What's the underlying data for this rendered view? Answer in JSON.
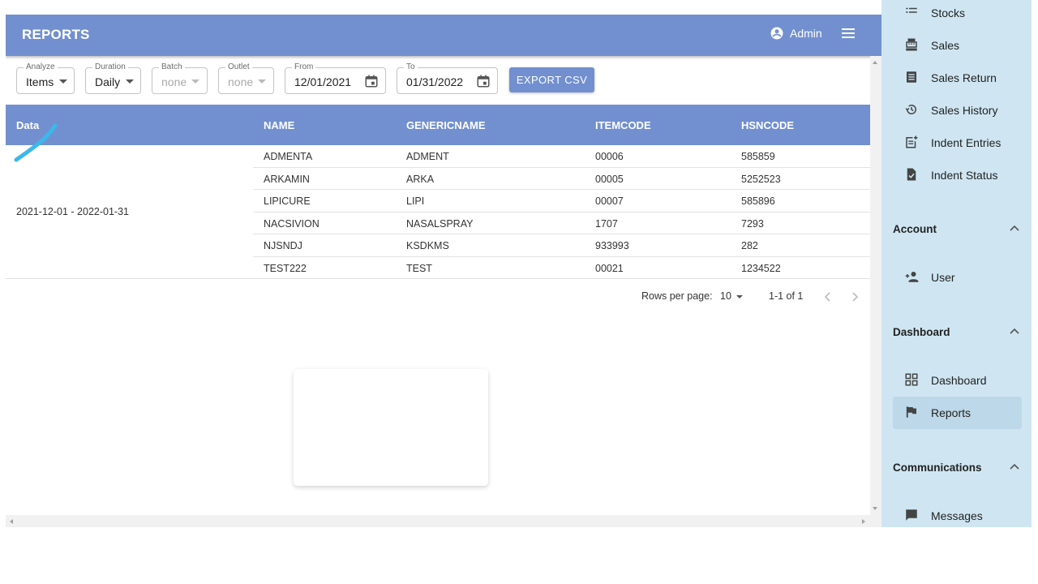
{
  "header": {
    "title": "REPORTS",
    "user_label": "Admin"
  },
  "filters": {
    "analyze": {
      "label": "Analyze",
      "value": "Items"
    },
    "duration": {
      "label": "Duration",
      "value": "Daily"
    },
    "batch": {
      "label": "Batch",
      "value": "none"
    },
    "outlet": {
      "label": "Outlet",
      "value": "none"
    },
    "from": {
      "label": "From",
      "value": "12/01/2021"
    },
    "to": {
      "label": "To",
      "value": "01/31/2022"
    },
    "export_label": "EXPORT CSV"
  },
  "table": {
    "columns": [
      "Data",
      "NAME",
      "GENERICNAME",
      "ITEMCODE",
      "HSNCODE"
    ],
    "data_range": "2021-12-01 - 2022-01-31",
    "rows": [
      {
        "name": "ADMENTA",
        "generic": "ADMENT",
        "itemcode": "00006",
        "hsn": "585859"
      },
      {
        "name": "ARKAMIN",
        "generic": "ARKA",
        "itemcode": "00005",
        "hsn": "5252523"
      },
      {
        "name": "LIPICURE",
        "generic": "LIPI",
        "itemcode": "00007",
        "hsn": "585896"
      },
      {
        "name": "NACSIVION",
        "generic": "NASALSPRAY",
        "itemcode": "1707",
        "hsn": "7293"
      },
      {
        "name": "NJSNDJ",
        "generic": "KSDKMS",
        "itemcode": "933993",
        "hsn": "282"
      },
      {
        "name": "TEST222",
        "generic": "TEST",
        "itemcode": "00021",
        "hsn": "1234522"
      }
    ]
  },
  "pagination": {
    "rows_per_page_label": "Rows per page:",
    "rows_per_page": "10",
    "range": "1-1 of 1"
  },
  "sidebar": {
    "items_top": [
      {
        "label": "Stocks",
        "icon": "list-icon"
      },
      {
        "label": "Sales",
        "icon": "cash-register-icon"
      },
      {
        "label": "Sales Return",
        "icon": "receipt-icon"
      },
      {
        "label": "Sales History",
        "icon": "history-icon"
      },
      {
        "label": "Indent Entries",
        "icon": "post-add-icon"
      },
      {
        "label": "Indent Status",
        "icon": "file-check-icon"
      }
    ],
    "sections": {
      "account": "Account",
      "dashboard": "Dashboard",
      "communications": "Communications"
    },
    "account_items": [
      {
        "label": "User",
        "icon": "person-add-icon"
      }
    ],
    "dashboard_items": [
      {
        "label": "Dashboard",
        "icon": "grid-icon"
      },
      {
        "label": "Reports",
        "icon": "flag-icon"
      }
    ],
    "communication_items": [
      {
        "label": "Messages",
        "icon": "chat-icon"
      }
    ]
  },
  "colors": {
    "primary": "#7290cf",
    "sidebar_bg": "#cfe6f2",
    "active_item_bg": "#bdd8e8",
    "annotation_stroke": "#3cb8ea"
  }
}
